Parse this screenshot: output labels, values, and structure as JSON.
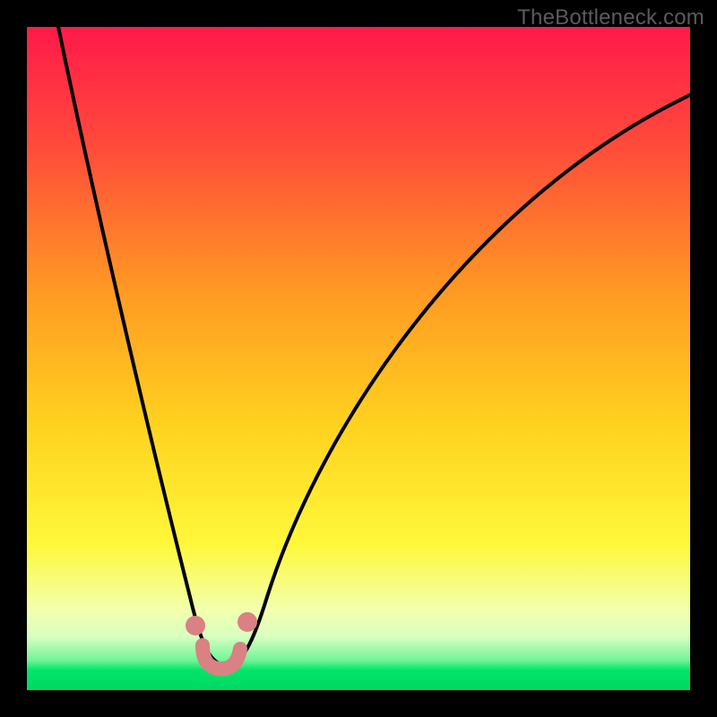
{
  "watermark": "TheBottleneck.com",
  "colors": {
    "frame": "#000000",
    "gradient_top": "#ff1a4a",
    "gradient_mid_upper": "#ff6a2b",
    "gradient_mid": "#ffcc1f",
    "gradient_mid_lower": "#f6ff3a",
    "gradient_pale": "#f3ffb0",
    "gradient_green": "#00e56a",
    "curve": "#000000",
    "marker": "#d98183"
  },
  "chart_data": {
    "type": "line",
    "title": "",
    "xlabel": "",
    "ylabel": "",
    "xlim": [
      0,
      100
    ],
    "ylim": [
      0,
      100
    ],
    "series": [
      {
        "name": "bottleneck-curve",
        "x": [
          5,
          10,
          15,
          20,
          25,
          27,
          29,
          31,
          33,
          35,
          40,
          50,
          60,
          70,
          80,
          90,
          100
        ],
        "y": [
          100,
          80,
          58,
          35,
          12,
          5,
          2,
          2,
          5,
          12,
          28,
          50,
          64,
          74,
          81,
          86,
          90
        ]
      }
    ],
    "markers": [
      {
        "name": "left-marker",
        "x": 27,
        "y": 5
      },
      {
        "name": "right-marker",
        "x": 33,
        "y": 5
      },
      {
        "name": "valley-marker",
        "x": 30,
        "y": 2
      }
    ],
    "annotations": []
  }
}
